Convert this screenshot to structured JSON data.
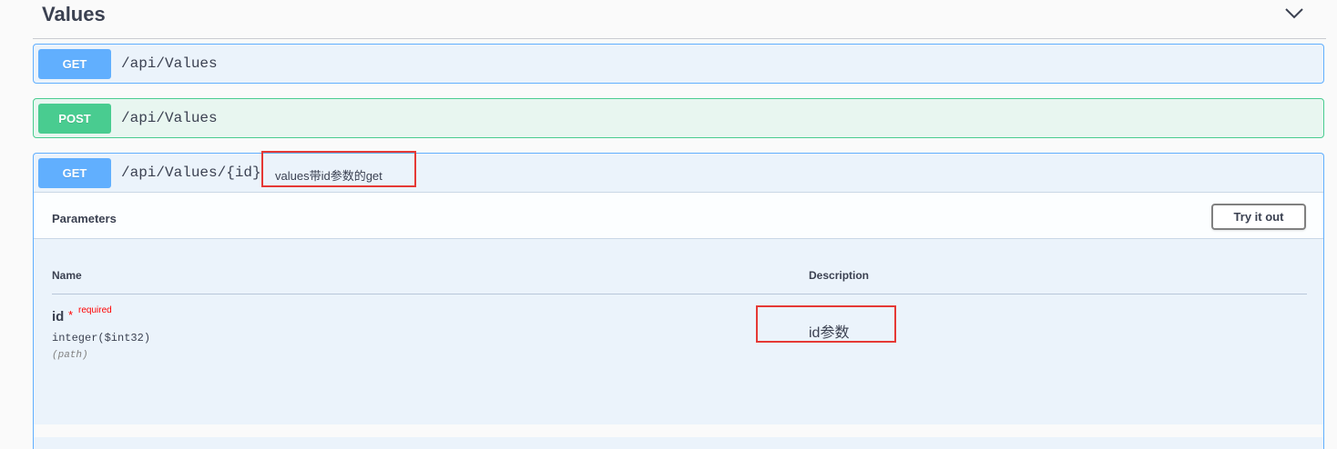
{
  "tag": {
    "title": "Values",
    "collapse_icon": "chevron-down-icon"
  },
  "operations": [
    {
      "method": "GET",
      "path": "/api/Values"
    },
    {
      "method": "POST",
      "path": "/api/Values"
    },
    {
      "method": "GET",
      "path": "/api/Values/{id}",
      "summary": "values带id参数的get",
      "parameters_title": "Parameters",
      "try_it_out_label": "Try it out",
      "table": {
        "name_header": "Name",
        "description_header": "Description",
        "rows": [
          {
            "name": "id",
            "required_star": "*",
            "required_label": "required",
            "type": "integer($int32)",
            "in": "(path)",
            "description": "id参数"
          }
        ]
      }
    }
  ],
  "colors": {
    "get": "#61affe",
    "post": "#49cc90",
    "highlight": "#e53935",
    "required": "#ff0000"
  }
}
